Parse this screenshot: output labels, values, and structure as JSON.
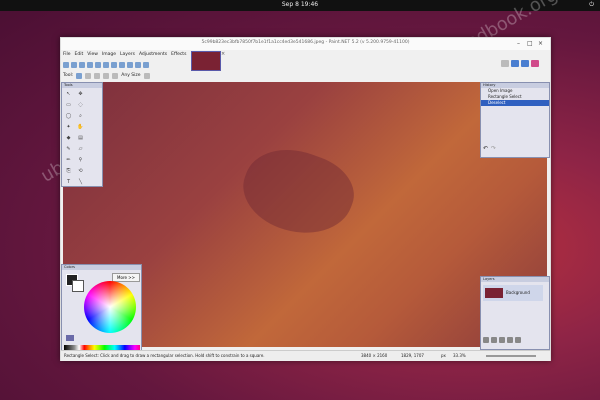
{
  "desktop": {
    "clock": "Sep 8  19:46"
  },
  "watermark": "ubuntuhandbook.org",
  "window": {
    "title": "5c99b823ec3bfb7850f7b1e1f1a1cc4ed3e541686.jpeg - Paint.NET 5.2 (v 5.200.9759-41100)",
    "controls": [
      "–",
      "□",
      "×"
    ]
  },
  "menu": [
    "File",
    "Edit",
    "View",
    "Image",
    "Layers",
    "Adjustments",
    "Effects"
  ],
  "toolbar2": {
    "tool_label": "Tool:",
    "antialias": "Any Size"
  },
  "history": {
    "title": "History",
    "items": [
      "Open Image",
      "Rectangle Select",
      "Deselect"
    ]
  },
  "tools": {
    "title": "Tools"
  },
  "colors": {
    "title": "Colors",
    "more_button": "More >>"
  },
  "layers": {
    "title": "Layers",
    "background": "Background"
  },
  "statusbar": {
    "hint": "Rectangle Select: Click and drag to draw a rectangular selection. Hold shift to constrain to a square.",
    "size": "3840 × 2160",
    "pos": "1829, 1707",
    "unit": "px",
    "zoom": "33.3%"
  },
  "accent": "#3060c0"
}
